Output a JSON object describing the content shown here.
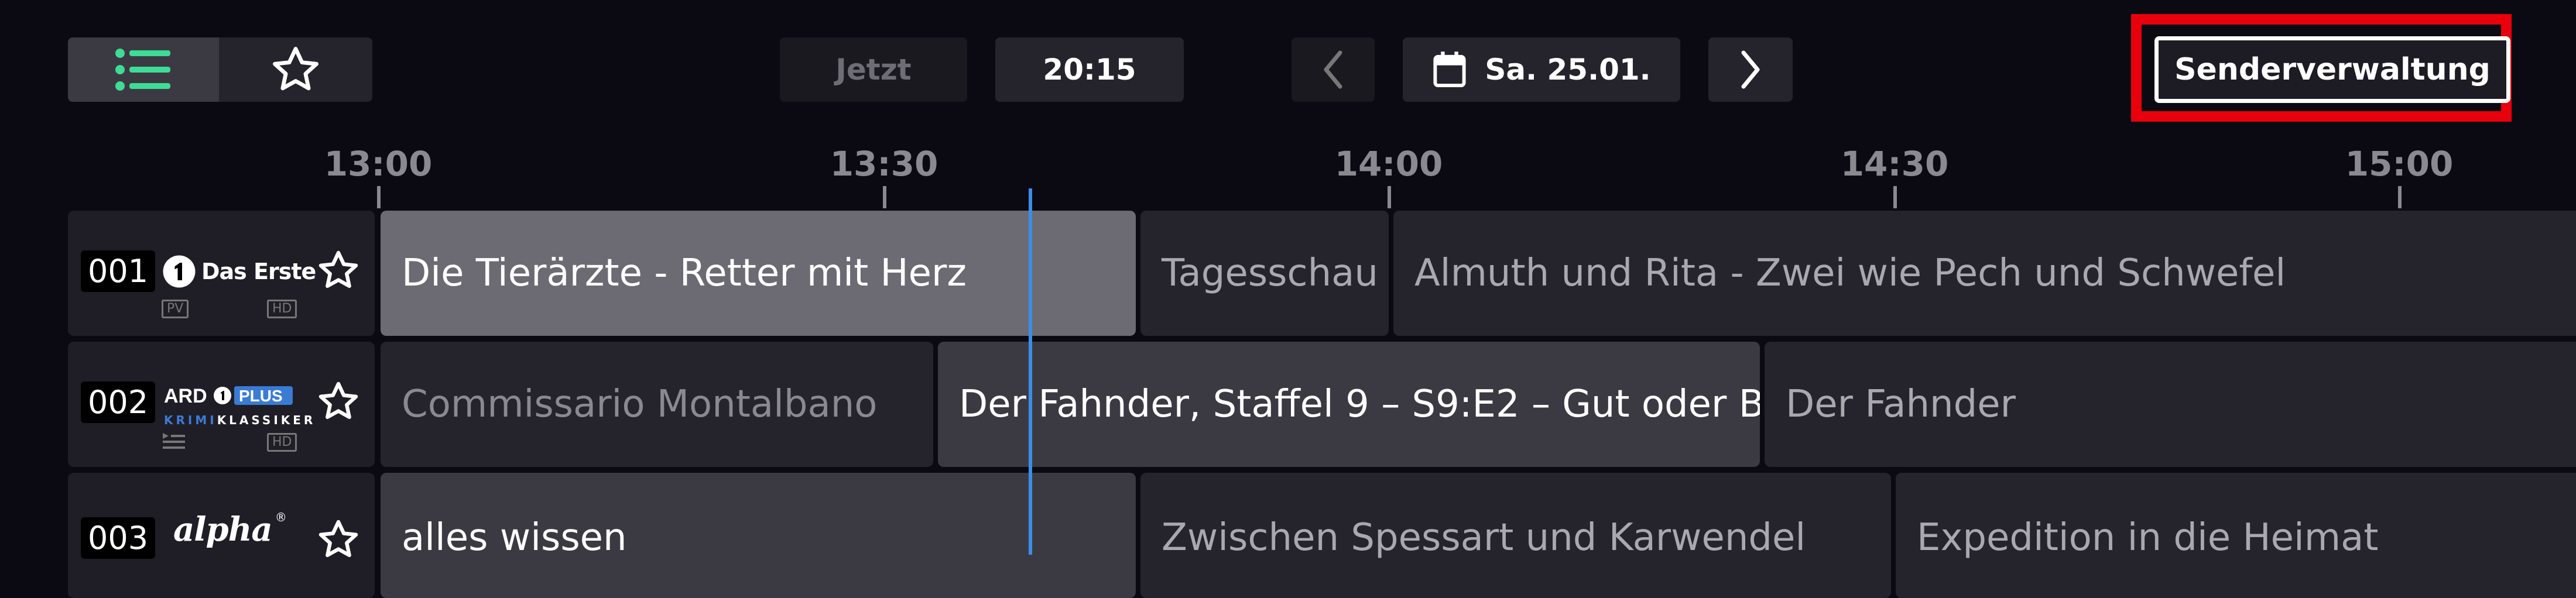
{
  "toolbar": {
    "now_label": "Jetzt",
    "time_label": "20:15",
    "date_label": "Sa. 25.01.",
    "channel_mgmt_label": "Senderverwaltung"
  },
  "timeline": {
    "ticks": [
      "13:00",
      "13:30",
      "14:00",
      "14:30",
      "15:00"
    ]
  },
  "channels": [
    {
      "number": "001",
      "logo_text": "Das Erste",
      "badges": [
        "PV",
        "HD"
      ],
      "programs": [
        {
          "title": "Die Tierärzte - Retter mit Herz",
          "state": "current"
        },
        {
          "title": "Tagesschau",
          "state": "future"
        },
        {
          "title": "Almuth und Rita - Zwei wie Pech und Schwefel",
          "state": "future"
        }
      ]
    },
    {
      "number": "002",
      "logo_text": "ARD PLUS KRIMIKLASSIKER",
      "badges": [
        "HD"
      ],
      "programs": [
        {
          "title": "Commissario Montalbano",
          "state": "past"
        },
        {
          "title": "Der Fahnder, Staffel 9 – S9:E2 – Gut oder B…",
          "state": "current"
        },
        {
          "title": "Der Fahnder",
          "state": "future"
        }
      ]
    },
    {
      "number": "003",
      "logo_text": "alpha",
      "badges": [],
      "programs": [
        {
          "title": "alles wissen",
          "state": "current"
        },
        {
          "title": "Zwischen Spessart und Karwendel",
          "state": "future"
        },
        {
          "title": "Expedition in die Heimat",
          "state": "future"
        }
      ]
    }
  ],
  "colors": {
    "background": "#0b0a13",
    "accent_green": "#3ddc97",
    "now_line": "#3a8ee6",
    "highlight_red": "#e8000c"
  }
}
